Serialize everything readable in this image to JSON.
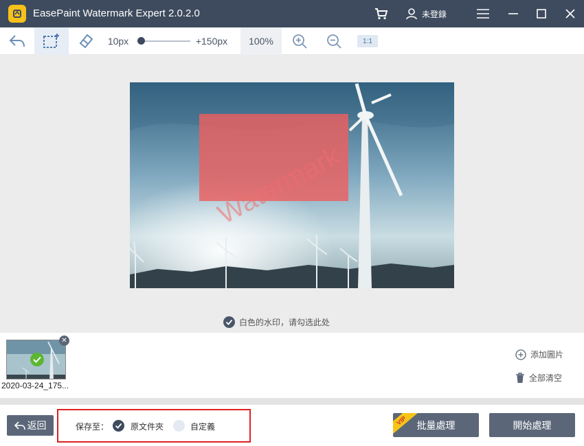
{
  "app": {
    "title": "EasePaint Watermark Expert  2.0.2.0",
    "login_label": "未登錄"
  },
  "toolbar": {
    "min_size": "10px",
    "max_size": "+150px",
    "zoom": "100%",
    "ratio": "1:1"
  },
  "canvas": {
    "watermark_text": "Watermark",
    "white_watermark_label": "白色的水印，请勾选此处"
  },
  "thumbnails": [
    {
      "name": "2020-03-24_175..."
    }
  ],
  "side_actions": {
    "add_image": "添加圖片",
    "clear_all": "全部清空"
  },
  "bottom": {
    "back_label": "返回",
    "save_to_label": "保存至：",
    "option_original": "原文件夾",
    "option_custom": "自定義",
    "batch_label": "批量處理",
    "vip_label": "VIP",
    "start_label": "開始處理"
  }
}
